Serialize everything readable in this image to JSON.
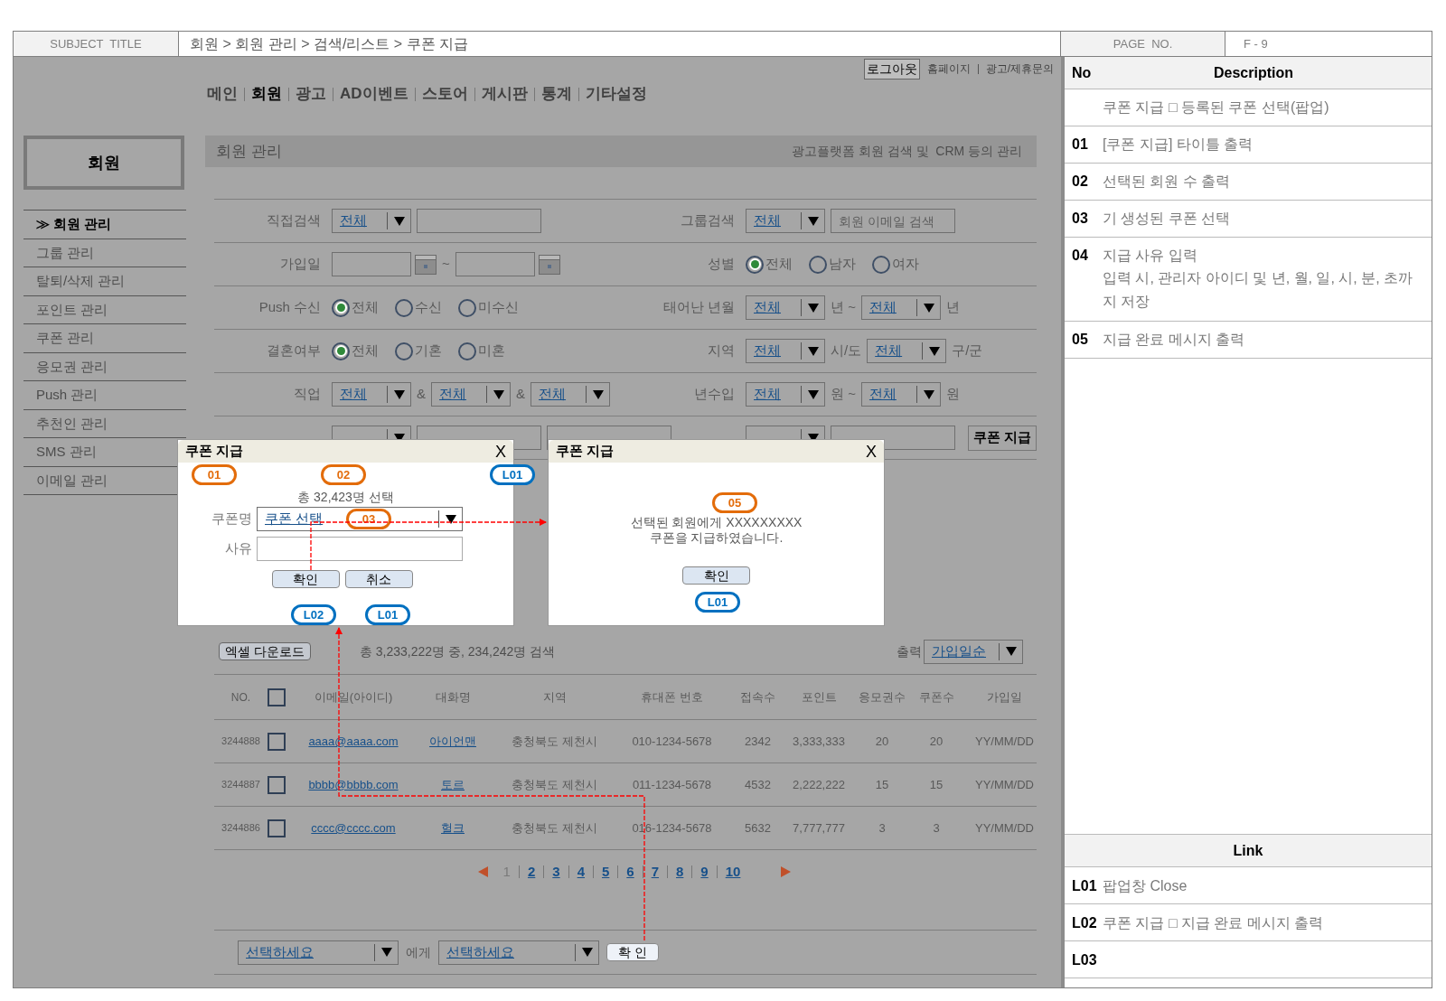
{
  "header": {
    "subject_label": "SUBJECT  TITLE",
    "breadcrumb": "회원 > 회원 관리 > 검색/리스트 > 쿠폰 지급",
    "page_label": "PAGE  NO.",
    "page_no": "F - 9"
  },
  "top_links": [
    {
      "label": "로그아웃",
      "kind": "button"
    },
    {
      "label": "홈페이지",
      "kind": "link"
    },
    {
      "label": "광고/제휴문의",
      "kind": "link"
    }
  ],
  "main_nav": [
    {
      "label": "메인",
      "selected": false
    },
    {
      "label": "회원",
      "selected": true
    },
    {
      "label": "광고",
      "selected": false
    },
    {
      "label": "AD이벤트",
      "selected": false
    },
    {
      "label": "스토어",
      "selected": false
    },
    {
      "label": "게시판",
      "selected": false
    },
    {
      "label": "통계",
      "selected": false
    },
    {
      "label": "기타설정",
      "selected": false
    }
  ],
  "sidebar": {
    "title": "회원",
    "items": [
      {
        "label": "≫ 회원 관리",
        "selected": true
      },
      {
        "label": "그룹 관리",
        "selected": false
      },
      {
        "label": "탈퇴/삭제 관리",
        "selected": false
      },
      {
        "label": "포인트 관리",
        "selected": false
      },
      {
        "label": "쿠폰 관리",
        "selected": false
      },
      {
        "label": "응모권 관리",
        "selected": false
      },
      {
        "label": "Push 관리",
        "selected": false
      },
      {
        "label": "추천인 관리",
        "selected": false
      },
      {
        "label": "SMS 관리",
        "selected": false
      },
      {
        "label": "이메일 관리",
        "selected": false
      }
    ]
  },
  "section": {
    "title": "회원 관리",
    "subtitle": "광고플랫폼 회원 검색 및  CRM 등의 관리"
  },
  "search_form": {
    "rows": [
      {
        "left": {
          "label": "직접검색",
          "controls": [
            {
              "kind": "select",
              "value": "전체"
            },
            {
              "kind": "input"
            }
          ]
        },
        "right": {
          "label": "그룹검색",
          "controls": [
            {
              "kind": "select",
              "value": "전체"
            },
            {
              "kind": "input",
              "placeholder": "회원 이메일 검색"
            }
          ]
        }
      },
      {
        "left": {
          "label": "가입일",
          "controls": [
            {
              "kind": "date"
            },
            {
              "kind": "text",
              "text": "~"
            },
            {
              "kind": "date"
            }
          ]
        },
        "right": {
          "label": "성별",
          "controls": [
            {
              "kind": "radio",
              "label": "전체",
              "selected": true
            },
            {
              "kind": "radio",
              "label": "남자",
              "selected": false
            },
            {
              "kind": "radio",
              "label": "여자",
              "selected": false
            }
          ]
        }
      },
      {
        "left": {
          "label": "Push 수신",
          "controls": [
            {
              "kind": "radio",
              "label": "전체",
              "selected": true
            },
            {
              "kind": "radio",
              "label": "수신",
              "selected": false
            },
            {
              "kind": "radio",
              "label": "미수신",
              "selected": false
            }
          ]
        },
        "right": {
          "label": "태어난 년월",
          "controls": [
            {
              "kind": "select",
              "value": "전체"
            },
            {
              "kind": "text",
              "text": "년 ~"
            },
            {
              "kind": "select",
              "value": "전체"
            },
            {
              "kind": "text",
              "text": "년"
            }
          ]
        }
      },
      {
        "left": {
          "label": "결혼여부",
          "controls": [
            {
              "kind": "radio",
              "label": "전체",
              "selected": true
            },
            {
              "kind": "radio",
              "label": "기혼",
              "selected": false
            },
            {
              "kind": "radio",
              "label": "미혼",
              "selected": false
            }
          ]
        },
        "right": {
          "label": "지역",
          "controls": [
            {
              "kind": "select",
              "value": "전체"
            },
            {
              "kind": "text",
              "text": "시/도"
            },
            {
              "kind": "select",
              "value": "전체"
            },
            {
              "kind": "text",
              "text": "구/군"
            }
          ]
        }
      },
      {
        "left": {
          "label": "직업",
          "controls": [
            {
              "kind": "select",
              "value": "전체"
            },
            {
              "kind": "text",
              "text": "&"
            },
            {
              "kind": "select",
              "value": "전체"
            },
            {
              "kind": "text",
              "text": "&"
            },
            {
              "kind": "select",
              "value": "전체"
            }
          ]
        },
        "right": {
          "label": "년수입",
          "controls": [
            {
              "kind": "select",
              "value": "전체"
            },
            {
              "kind": "text",
              "text": "원 ~"
            },
            {
              "kind": "select",
              "value": "전체"
            },
            {
              "kind": "text",
              "text": "원"
            }
          ]
        }
      },
      {
        "left": {
          "controls": [
            {
              "kind": "select"
            },
            {
              "kind": "input"
            },
            {
              "kind": "input"
            }
          ]
        },
        "right": {
          "controls": [
            {
              "kind": "select"
            },
            {
              "kind": "input"
            }
          ]
        },
        "button": "쿠폰 지급"
      }
    ]
  },
  "popup_form": {
    "title": "쿠폰 지급",
    "close": "X",
    "summary": "총 32,423명 선택",
    "fields": [
      {
        "label": "쿠폰명",
        "kind": "select",
        "value": "쿠폰 선택"
      },
      {
        "label": "사유",
        "kind": "input"
      }
    ],
    "buttons": [
      "확인",
      "취소"
    ],
    "markers": [
      {
        "label": "01",
        "kind": "description"
      },
      {
        "label": "02",
        "kind": "description"
      },
      {
        "label": "L01",
        "kind": "link"
      },
      {
        "label": "03",
        "kind": "description"
      },
      {
        "label": "L02",
        "kind": "link"
      },
      {
        "label": "L01",
        "kind": "link"
      }
    ]
  },
  "popup_done": {
    "title": "쿠폰 지급",
    "close": "X",
    "message": [
      "선택된 회원에게 XXXXXXXXX",
      "쿠폰을 지급하였습니다."
    ],
    "buttons": [
      "확인"
    ],
    "markers": [
      {
        "label": "05",
        "kind": "description"
      },
      {
        "label": "L01",
        "kind": "link"
      }
    ]
  },
  "results": {
    "excel_button": "엑셀 다운로드",
    "summary": "총 3,233,222명 중, 234,242명 검색",
    "sort_label": "출력",
    "sort_value": "가입일순"
  },
  "table": {
    "no_label": "NO.",
    "header_checked": false,
    "columns": [
      {
        "label": "이메일(아이디)",
        "kind": "link"
      },
      {
        "label": "대화명",
        "kind": "link"
      },
      {
        "label": "지역",
        "kind": "text"
      },
      {
        "label": "휴대폰 번호",
        "kind": "text"
      },
      {
        "label": "접속수",
        "kind": "text"
      },
      {
        "label": "포인트",
        "kind": "text"
      },
      {
        "label": "응모권수",
        "kind": "text"
      },
      {
        "label": "쿠폰수",
        "kind": "text"
      },
      {
        "label": "가입일",
        "kind": "text"
      }
    ],
    "rows": [
      {
        "no": "3244888",
        "checked": false,
        "cells": [
          "aaaa@aaaa.com",
          "아이언맨",
          "충청북도 제천시",
          "010-1234-5678",
          "2342",
          "3,333,333",
          "20",
          "20",
          "YY/MM/DD"
        ]
      },
      {
        "no": "3244887",
        "checked": false,
        "cells": [
          "bbbb@bbbb.com",
          "토르",
          "충청북도 제천시",
          "011-1234-5678",
          "4532",
          "2,222,222",
          "15",
          "15",
          "YY/MM/DD"
        ]
      },
      {
        "no": "3244886",
        "checked": false,
        "cells": [
          "cccc@cccc.com",
          "헐크",
          "충청북도 제천시",
          "016-1234-5678",
          "5632",
          "7,777,777",
          "3",
          "3",
          "YY/MM/DD"
        ]
      }
    ]
  },
  "pagination": {
    "pages": [
      {
        "label": "1",
        "selected": true
      },
      {
        "label": "2",
        "selected": false
      },
      {
        "label": "3",
        "selected": false
      },
      {
        "label": "4",
        "selected": false
      },
      {
        "label": "5",
        "selected": false
      },
      {
        "label": "6",
        "selected": false
      },
      {
        "label": "7",
        "selected": false
      },
      {
        "label": "8",
        "selected": false
      },
      {
        "label": "9",
        "selected": false
      },
      {
        "label": "10",
        "selected": false
      }
    ]
  },
  "bottom_bar": {
    "from_value": "선택하세요",
    "between": "에게",
    "to_value": "선택하세요",
    "button": "확 인"
  },
  "description": {
    "no_header": "No",
    "text_header": "Description",
    "rows": [
      {
        "text": "쿠폰 지급 □ 등록된 쿠폰 선택(팝업)"
      },
      {
        "no": "01",
        "text": "[쿠폰 지급] 타이틀 출력"
      },
      {
        "no": "02",
        "text": "선택된 회원 수 출력"
      },
      {
        "no": "03",
        "text": "기 생성된 쿠폰 선택"
      },
      {
        "no": "04",
        "text": "지급 사유 입력",
        "note": "입력 시, 관리자 아이디 및 년, 월, 일, 시, 분, 초까지 저장"
      },
      {
        "no": "05",
        "text": "지급 완료 메시지 출력"
      }
    ]
  },
  "links": {
    "title": "Link",
    "rows": [
      {
        "no": "L01",
        "text": "팝업창 Close"
      },
      {
        "no": "L02",
        "text": "쿠폰 지급 □ 지급 완료 메시지 출력"
      },
      {
        "no": "L03"
      }
    ]
  }
}
